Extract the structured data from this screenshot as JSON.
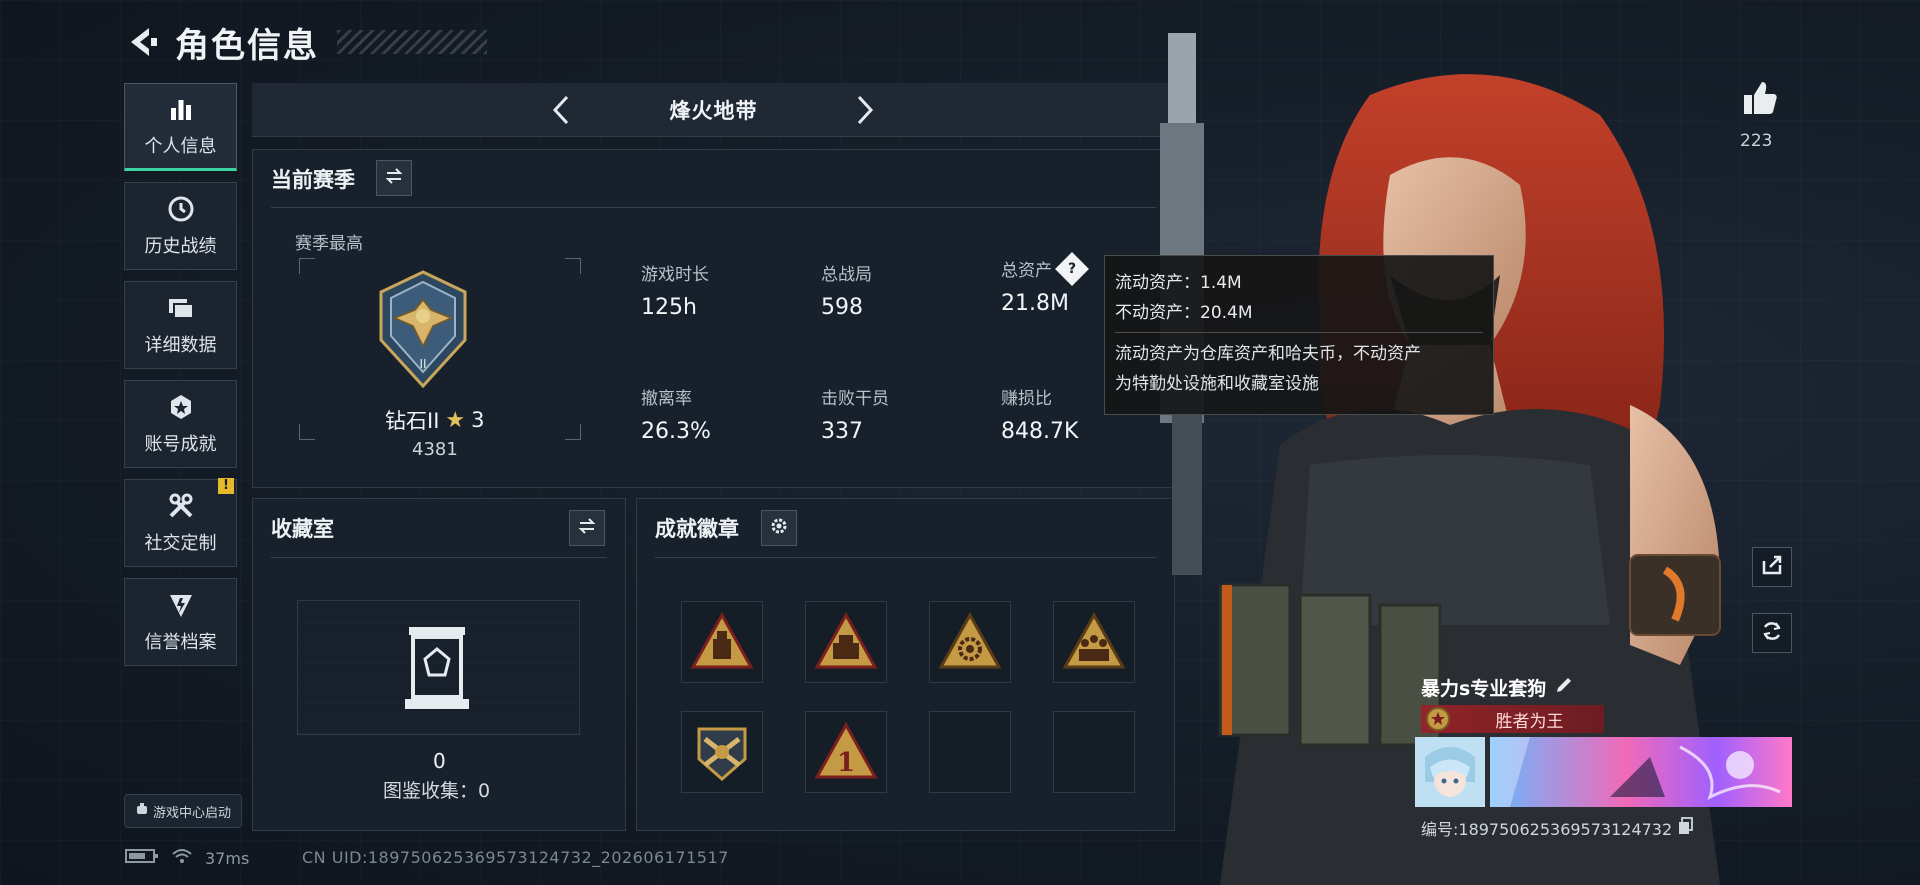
{
  "header": {
    "title": "角色信息"
  },
  "nav": {
    "items": [
      {
        "label": "个人信息",
        "icon": "bar-chart-icon",
        "active": true
      },
      {
        "label": "历史战绩",
        "icon": "history-clock-icon"
      },
      {
        "label": "详细数据",
        "icon": "folder-icon"
      },
      {
        "label": "账号成就",
        "icon": "achievement-medal-icon"
      },
      {
        "label": "社交定制",
        "icon": "tools-icon",
        "badge": "!"
      },
      {
        "label": "信誉档案",
        "icon": "shield-bolt-icon"
      }
    ],
    "game_center": "游戏中心启动"
  },
  "mode": {
    "name": "烽火地带"
  },
  "season": {
    "title": "当前赛季",
    "subtitle": "赛季最高",
    "rank_name": "钻石II",
    "rank_stars": "3",
    "rank_score": "4381",
    "stats": [
      {
        "label": "游戏时长",
        "value": "125h"
      },
      {
        "label": "总战局",
        "value": "598"
      },
      {
        "label": "总资产",
        "value": "21.8M"
      },
      {
        "label": "撤离率",
        "value": "26.3%"
      },
      {
        "label": "击败干员",
        "value": "337"
      },
      {
        "label": "赚损比",
        "value": "848.7K"
      }
    ]
  },
  "tooltip": {
    "line1": "流动资产：1.4M",
    "line2": "不动资产：20.4M",
    "desc1": "流动资产为仓库资产和哈夫币，不动资产",
    "desc2": "为特勤处设施和收藏室设施"
  },
  "collection": {
    "title": "收藏室",
    "count": "0",
    "stat": "图鉴收集：0"
  },
  "badges": {
    "title": "成就徽章",
    "slots": [
      {
        "icon": "lantern-badge-icon",
        "filled": true
      },
      {
        "icon": "crate-badge-icon",
        "filled": true
      },
      {
        "icon": "gear-star-badge-icon",
        "filled": true
      },
      {
        "icon": "soldiers-badge-icon",
        "filled": true
      },
      {
        "icon": "crossed-guns-badge-icon",
        "filled": true
      },
      {
        "icon": "number-one-badge-icon",
        "filled": true
      },
      {
        "icon": "empty-slot",
        "filled": false
      },
      {
        "icon": "empty-slot",
        "filled": false
      }
    ]
  },
  "status": {
    "ping": "37ms",
    "uid": "CN UID:18975062536957312473​2_202606171517"
  },
  "profile": {
    "likes": "223",
    "player_name": "暴力s专业套狗",
    "title_tag": "胜者为王",
    "player_id": "编号:18975062536957312473​2"
  },
  "colors": {
    "accent": "#3fd3a0",
    "warning": "#e6b82a",
    "title_tag": "#962328",
    "gold": "#d9b25a"
  }
}
